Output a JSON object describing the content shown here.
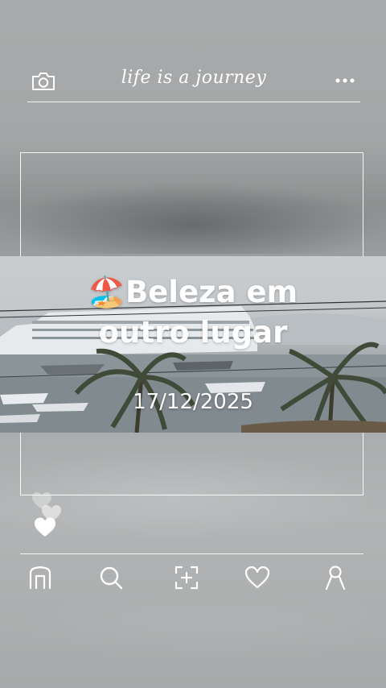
{
  "header": {
    "title": "life is a journey",
    "left_icon": "camera-icon",
    "right_icon": "more-dots-icon"
  },
  "post": {
    "title_emoji": "🏖️",
    "title_line1": "Beleza em",
    "title_line2": "outro lugar",
    "date": "17/12/2025"
  },
  "likes": {
    "icon": "hearts-icon"
  },
  "nav": {
    "items": [
      {
        "name": "home",
        "icon": "home-icon"
      },
      {
        "name": "search",
        "icon": "search-icon"
      },
      {
        "name": "add",
        "icon": "add-icon"
      },
      {
        "name": "likes",
        "icon": "heart-icon"
      },
      {
        "name": "profile",
        "icon": "profile-icon"
      }
    ]
  },
  "colors": {
    "foreground": "#ffffff",
    "background": "#a6a8a9"
  }
}
